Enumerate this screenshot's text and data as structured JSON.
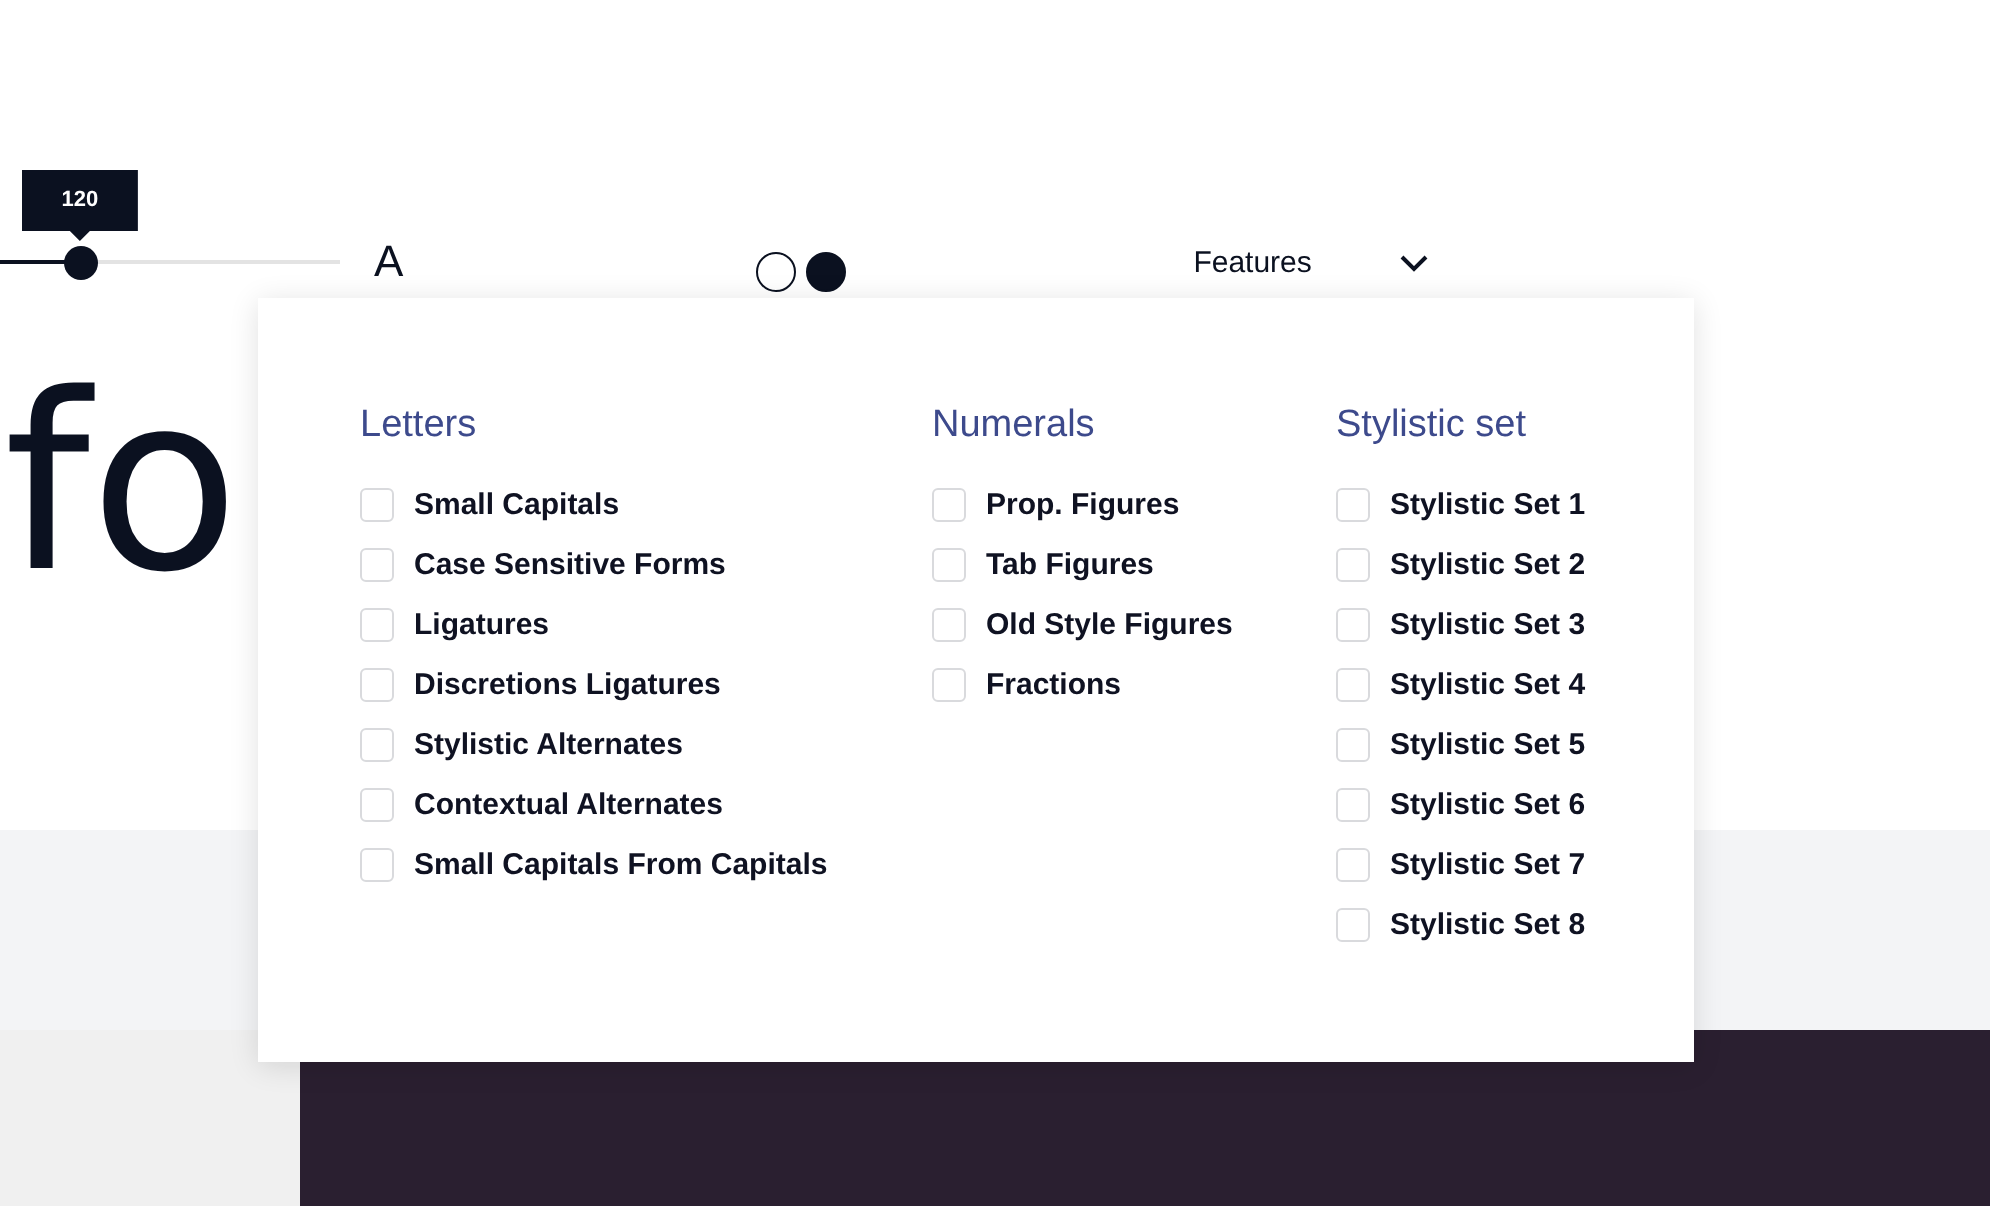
{
  "toolbar": {
    "size_slider": {
      "value": "120",
      "level": 0.235
    },
    "glyph": "A",
    "swatches": [
      {
        "color": "#ffffff"
      },
      {
        "color": "#0b1120"
      }
    ],
    "features_dropdown": {
      "label": "Features",
      "expanded": true
    }
  },
  "sample_text": "fo",
  "features_panel": {
    "groups": [
      {
        "title": "Letters",
        "options": [
          {
            "label": "Small Capitals",
            "checked": false
          },
          {
            "label": "Case Sensitive Forms",
            "checked": false
          },
          {
            "label": "Ligatures",
            "checked": false
          },
          {
            "label": "Discretions Ligatures",
            "checked": false
          },
          {
            "label": "Stylistic Alternates",
            "checked": false
          },
          {
            "label": "Contextual Alternates",
            "checked": false
          },
          {
            "label": "Small Capitals From Capitals",
            "checked": false
          }
        ]
      },
      {
        "title": "Numerals",
        "options": [
          {
            "label": "Prop. Figures",
            "checked": false
          },
          {
            "label": "Tab Figures",
            "checked": false
          },
          {
            "label": "Old Style Figures",
            "checked": false
          },
          {
            "label": "Fractions",
            "checked": false
          }
        ]
      },
      {
        "title": "Stylistic set",
        "options": [
          {
            "label": "Stylistic Set 1",
            "checked": false
          },
          {
            "label": "Stylistic Set 2",
            "checked": false
          },
          {
            "label": "Stylistic Set 3",
            "checked": false
          },
          {
            "label": "Stylistic Set 4",
            "checked": false
          },
          {
            "label": "Stylistic Set 5",
            "checked": false
          },
          {
            "label": "Stylistic Set 6",
            "checked": false
          },
          {
            "label": "Stylistic Set 7",
            "checked": false
          },
          {
            "label": "Stylistic Set 8",
            "checked": false
          }
        ]
      }
    ]
  }
}
